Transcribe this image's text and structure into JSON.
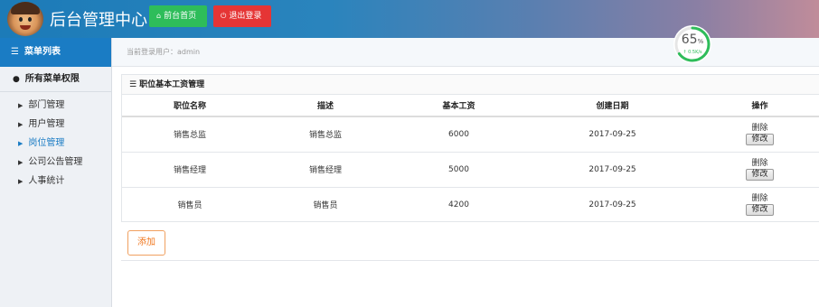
{
  "header": {
    "title": "后台管理中心",
    "home_button": "前台首页",
    "logout_button": "退出登录",
    "home_icon": "home-icon",
    "logout_icon": "power-icon"
  },
  "sidebar": {
    "head": "菜单列表",
    "section": "所有菜单权限",
    "items": [
      {
        "label": "部门管理",
        "active": false
      },
      {
        "label": "用户管理",
        "active": false
      },
      {
        "label": "岗位管理",
        "active": true
      },
      {
        "label": "公司公告管理",
        "active": false
      },
      {
        "label": "人事统计",
        "active": false
      }
    ]
  },
  "infobar": {
    "current_user": "当前登录用户：admin"
  },
  "gauge": {
    "percent": "65",
    "percent_unit": "%",
    "speed": "↑ 0.5K/s",
    "value": 0.65
  },
  "panel": {
    "title": "职位基本工资管理",
    "columns": [
      "职位名称",
      "描述",
      "基本工资",
      "创建日期",
      "操作"
    ],
    "rows": [
      {
        "name": "销售总监",
        "desc": "销售总监",
        "salary": "6000",
        "date": "2017-09-25",
        "del": "删除",
        "edit": "修改"
      },
      {
        "name": "销售经理",
        "desc": "销售经理",
        "salary": "5000",
        "date": "2017-09-25",
        "del": "删除",
        "edit": "修改"
      },
      {
        "name": "销售员",
        "desc": "销售员",
        "salary": "4200",
        "date": "2017-09-25",
        "del": "删除",
        "edit": "修改"
      }
    ]
  },
  "add_button": "添加",
  "colors": {
    "header_blue": "#1c7bb8",
    "sidebar_active": "#1a7cc4",
    "home_green": "#2ebd5a",
    "logout_red": "#e53535",
    "add_orange": "#f07820"
  }
}
